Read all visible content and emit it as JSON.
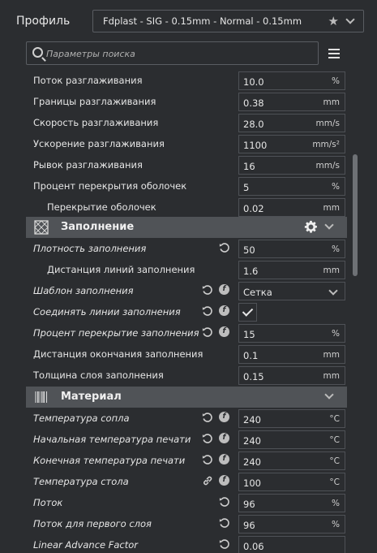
{
  "profile": {
    "label": "Профиль",
    "value": "Fdplast - SIG - 0.15mm - Normal - 0.15mm"
  },
  "search": {
    "placeholder": "Параметры поиска"
  },
  "rows_top": [
    {
      "label": "Поток разглаживания",
      "value": "10.0",
      "unit": "%"
    },
    {
      "label": "Границы разглаживания",
      "value": "0.38",
      "unit": "mm"
    },
    {
      "label": "Скорость разглаживания",
      "value": "28.0",
      "unit": "mm/s"
    },
    {
      "label": "Ускорение разглаживания",
      "value": "1100",
      "unit": "mm/s²"
    },
    {
      "label": "Рывок разглаживания",
      "value": "16",
      "unit": "mm/s"
    },
    {
      "label": "Процент перекрытия оболочек",
      "value": "5",
      "unit": "%"
    },
    {
      "label": "Перекрытие оболочек",
      "value": "0.02",
      "unit": "mm"
    }
  ],
  "infill": {
    "title": "Заполнение",
    "density_label": "Плотность заполнения",
    "density_value": "50",
    "density_unit": "%",
    "line_dist_label": "Дистанция линий заполнения",
    "line_dist_value": "1.6",
    "line_dist_unit": "mm",
    "pattern_label": "Шаблон заполнения",
    "pattern_value": "Сетка",
    "connect_label": "Соединять линии заполнения",
    "overlap_label": "Процент перекрытие заполнения",
    "overlap_value": "15",
    "overlap_unit": "%",
    "wipe_label": "Дистанция окончания заполнения",
    "wipe_value": "0.1",
    "wipe_unit": "mm",
    "layer_label": "Толщина слоя заполнения",
    "layer_value": "0.15",
    "layer_unit": "mm"
  },
  "material": {
    "title": "Материал",
    "rows": [
      {
        "label": "Температура сопла",
        "value": "240",
        "unit": "°C"
      },
      {
        "label": "Начальная температура печати",
        "value": "240",
        "unit": "°C"
      },
      {
        "label": "Конечная температура печати",
        "value": "240",
        "unit": "°C"
      },
      {
        "label": "Температура стола",
        "value": "100",
        "unit": "°C"
      },
      {
        "label": "Поток",
        "value": "96",
        "unit": "%"
      },
      {
        "label": "Поток для первого слоя",
        "value": "96",
        "unit": "%"
      },
      {
        "label": "Linear Advance Factor",
        "value": "0.06",
        "unit": ""
      }
    ]
  },
  "colors": {
    "background": "#2b2d30",
    "section": "#505357",
    "border": "#4e5156"
  }
}
